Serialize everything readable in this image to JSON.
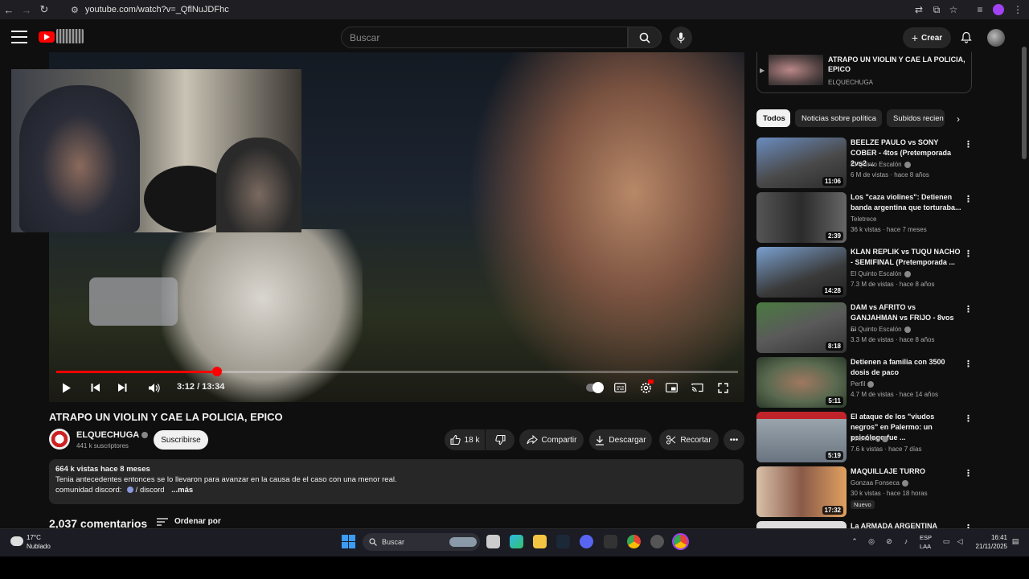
{
  "browser": {
    "url": "youtube.com/watch?v=_QflNuJDFhc"
  },
  "header": {
    "search_placeholder": "Buscar",
    "create_label": "Crear"
  },
  "player": {
    "current_time": "3:12",
    "duration": "13:34",
    "time_display": "3:12 / 13:34",
    "progress_fraction": 0.236
  },
  "video": {
    "title": "ATRAPO UN VIOLIN Y CAE LA POLICIA, EPICO",
    "channel": "ELQUECHUGA",
    "subscribers": "441 k suscriptores",
    "subscribe_label": "Suscribirse",
    "likes": "18 k",
    "share_label": "Compartir",
    "download_label": "Descargar",
    "clip_label": "Recortar"
  },
  "description": {
    "meta": "664 k vistas  hace 8 meses",
    "line1": "Tenia antecedentes entonces se lo llevaron para avanzar en la causa de el caso con una menor real.",
    "line2_prefix": "comunidad discord:",
    "line2_link": " / discord",
    "more": "...más"
  },
  "comments": {
    "count": "2,037 comentarios",
    "sort_label": "Ordenar por"
  },
  "sidebar": {
    "playlist": {
      "title": "ATRAPO UN VIOLIN Y CAE LA POLICIA, EPICO",
      "channel": "ELQUECHUGA"
    },
    "chips": [
      "Todos",
      "Noticias sobre política",
      "Subidos recien"
    ],
    "recommendations": [
      {
        "title": "BEELZE PAULO vs SONY COBER - 4tos (Pretemporada 2vs2 ...",
        "channel": "El Quinto Escalón",
        "meta": "6 M de vistas · hace 8 años",
        "duration": "11:06"
      },
      {
        "title": "Los \"caza violines\": Detienen banda argentina que torturaba...",
        "channel": "Teletrece",
        "meta": "36 k vistas · hace 7 meses",
        "duration": "2:39"
      },
      {
        "title": "KLAN REPLIK vs TUQU NACHO - SEMIFINAL (Pretemporada ...",
        "channel": "El Quinto Escalón",
        "meta": "7.3 M de vistas · hace 8 años",
        "duration": "14:28"
      },
      {
        "title": "DAM vs AFRITO vs GANJAHMAN vs FRIJO - 8vos ...",
        "channel": "El Quinto Escalón",
        "meta": "3.3 M de vistas · hace 8 años",
        "duration": "8:18"
      },
      {
        "title": "Detienen a familia con 3500 dosis de paco",
        "channel": "Perfil",
        "meta": "4.7 M de vistas · hace 14 años",
        "duration": "5:11"
      },
      {
        "title": "El ataque de los \"viudos negros\" en Palermo: un psicólogo fue ...",
        "channel": "Telenoche",
        "meta": "7.6 k vistas · hace 7 días",
        "duration": "5:19"
      },
      {
        "title": "MAQUILLAJE TURRO",
        "channel": "Gonzaa Fonseca",
        "meta": "30 k vistas · hace 18 horas",
        "duration": "17:32",
        "badge": "Nuevo"
      },
      {
        "title": "La ARMADA ARGENTINA",
        "channel": "",
        "meta": "",
        "duration": ""
      }
    ]
  },
  "taskbar": {
    "temperature": "17°C",
    "weather": "Nublado",
    "search_label": "Buscar",
    "lang1": "ESP",
    "lang2": "LAA",
    "time": "16:41",
    "date": "21/11/2025"
  },
  "colors": {
    "accent_red": "#ff0000",
    "bg": "#0f0f0f",
    "pill_bg": "#272727"
  }
}
